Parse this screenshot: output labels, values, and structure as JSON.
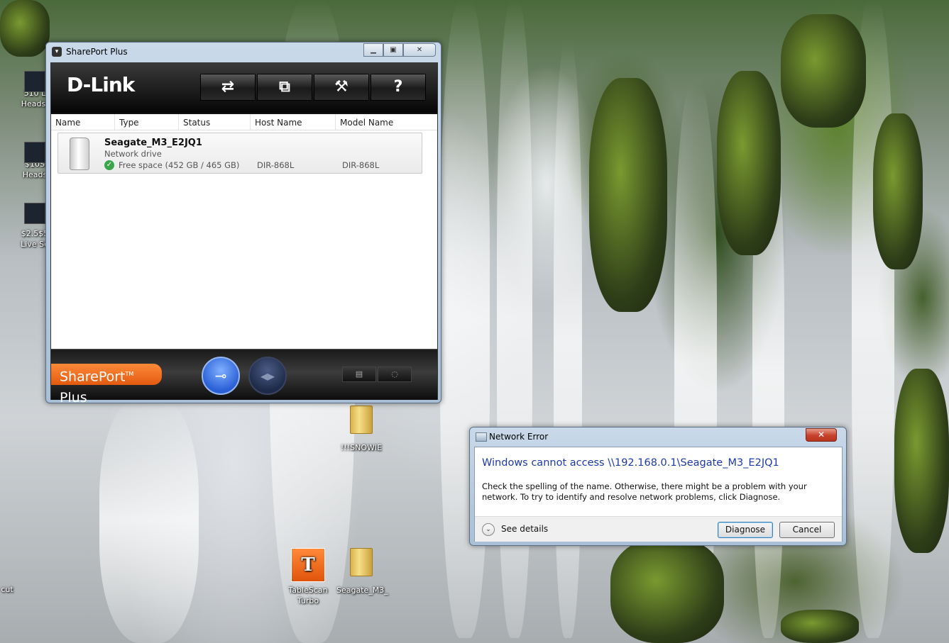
{
  "desktop": {
    "left_icons": [
      {
        "label1": "510 L",
        "label2": "Heads-"
      },
      {
        "label1": "$10S",
        "label2": "Heads"
      },
      {
        "label1": "$2.5$5",
        "label2": "Live Se"
      }
    ],
    "left_edge_label": "cut",
    "folder_snowie": "!!!SNOWIE",
    "tablescan": {
      "label1": "TableScan",
      "label2": "Turbo"
    },
    "seagate_shortcut": "Seagate_M3_"
  },
  "sharport": {
    "title": "SharePort Plus",
    "logo": "D-Link",
    "columns": [
      "Name",
      "Type",
      "Status",
      "Host Name",
      "Model Name"
    ],
    "device": {
      "name": "Seagate_M3_E2JQ1",
      "type": "Network drive",
      "status": "Free space (452 GB / 465 GB)",
      "host": "DIR-868L",
      "model": "DIR-868L"
    },
    "brand_main": "SharePort",
    "brand_tm": "TM",
    "brand_plus": " Plus"
  },
  "network_error": {
    "title": "Network Error",
    "message": "Windows cannot access \\\\192.168.0.1\\Seagate_M3_E2JQ1",
    "description": "Check the spelling of the name. Otherwise, there might be a problem with your network. To try to identify and resolve network problems, click Diagnose.",
    "see_details": "See details",
    "diagnose": "Diagnose",
    "cancel": "Cancel",
    "close_glyph": "✕"
  }
}
